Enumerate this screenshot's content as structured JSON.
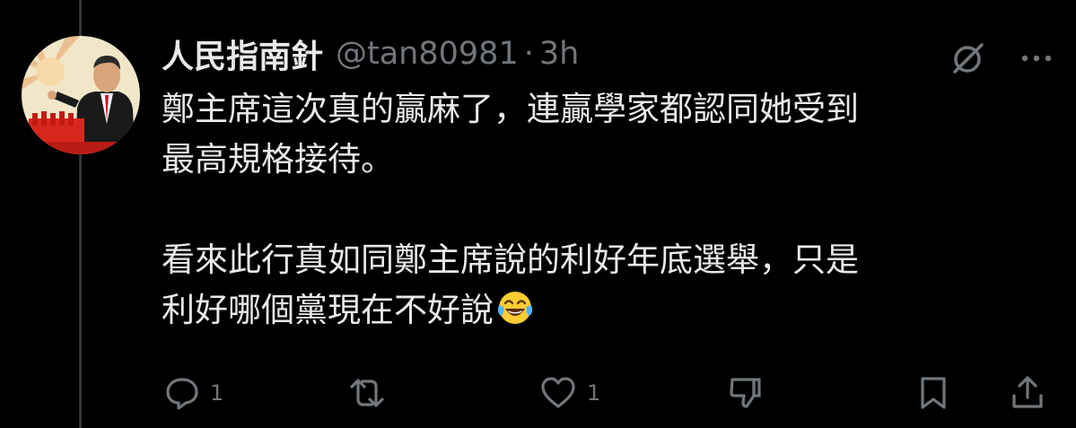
{
  "post": {
    "display_name": "人民指南針",
    "handle": "@tan80981",
    "separator": "·",
    "time": "3h",
    "text_lines": [
      "鄭主席這次真的贏麻了，連贏學家都認同她受到",
      "最高規格接待。",
      "看來此行真如同鄭主席說的利好年底選舉，只是",
      "利好哪個黨現在不好說"
    ],
    "emoji": "tears-of-joy-emoji"
  },
  "actions": {
    "reply_count": "1",
    "like_count": "1"
  },
  "icons": {
    "grok": "grok-icon",
    "more": "more-icon",
    "reply": "reply-icon",
    "repost": "repost-icon",
    "like": "heart-icon",
    "dislike": "thumbs-down-icon",
    "bookmark": "bookmark-icon",
    "share": "share-icon"
  },
  "colors": {
    "background": "#000000",
    "text": "#e7e9ea",
    "muted": "#71767b",
    "thread_line": "#333639"
  }
}
